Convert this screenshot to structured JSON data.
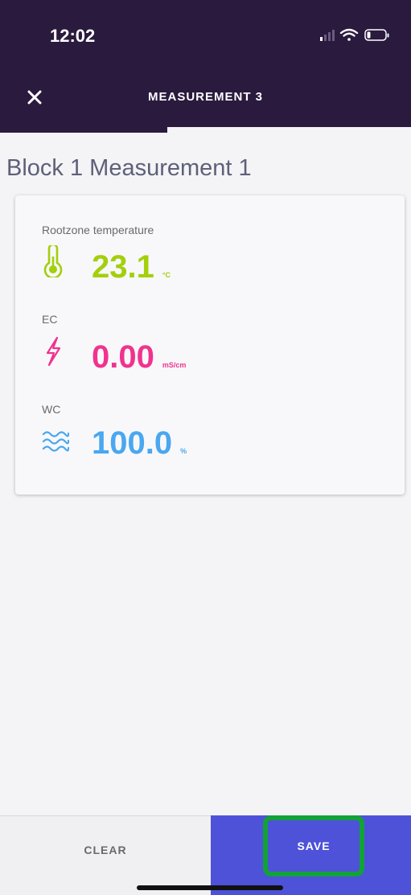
{
  "status_bar": {
    "time": "12:02"
  },
  "header": {
    "title": "MEASUREMENT 3",
    "close_icon": "close-icon"
  },
  "page": {
    "heading": "Block 1 Measurement 1"
  },
  "metrics": [
    {
      "label": "Rootzone temperature",
      "value": "23.1",
      "unit": "°C",
      "icon": "thermometer-icon",
      "color": "#a3cf0c"
    },
    {
      "label": "EC",
      "value": "0.00",
      "unit": "mS/cm",
      "icon": "lightning-icon",
      "color": "#f0338e"
    },
    {
      "label": "WC",
      "value": "100.0",
      "unit": "%",
      "icon": "water-waves-icon",
      "color": "#4aa7f0"
    }
  ],
  "actions": {
    "clear_label": "CLEAR",
    "save_label": "SAVE"
  },
  "colors": {
    "header_bg": "#2a1a3e",
    "save_bg": "#4d52d9",
    "highlight": "#12a238"
  }
}
